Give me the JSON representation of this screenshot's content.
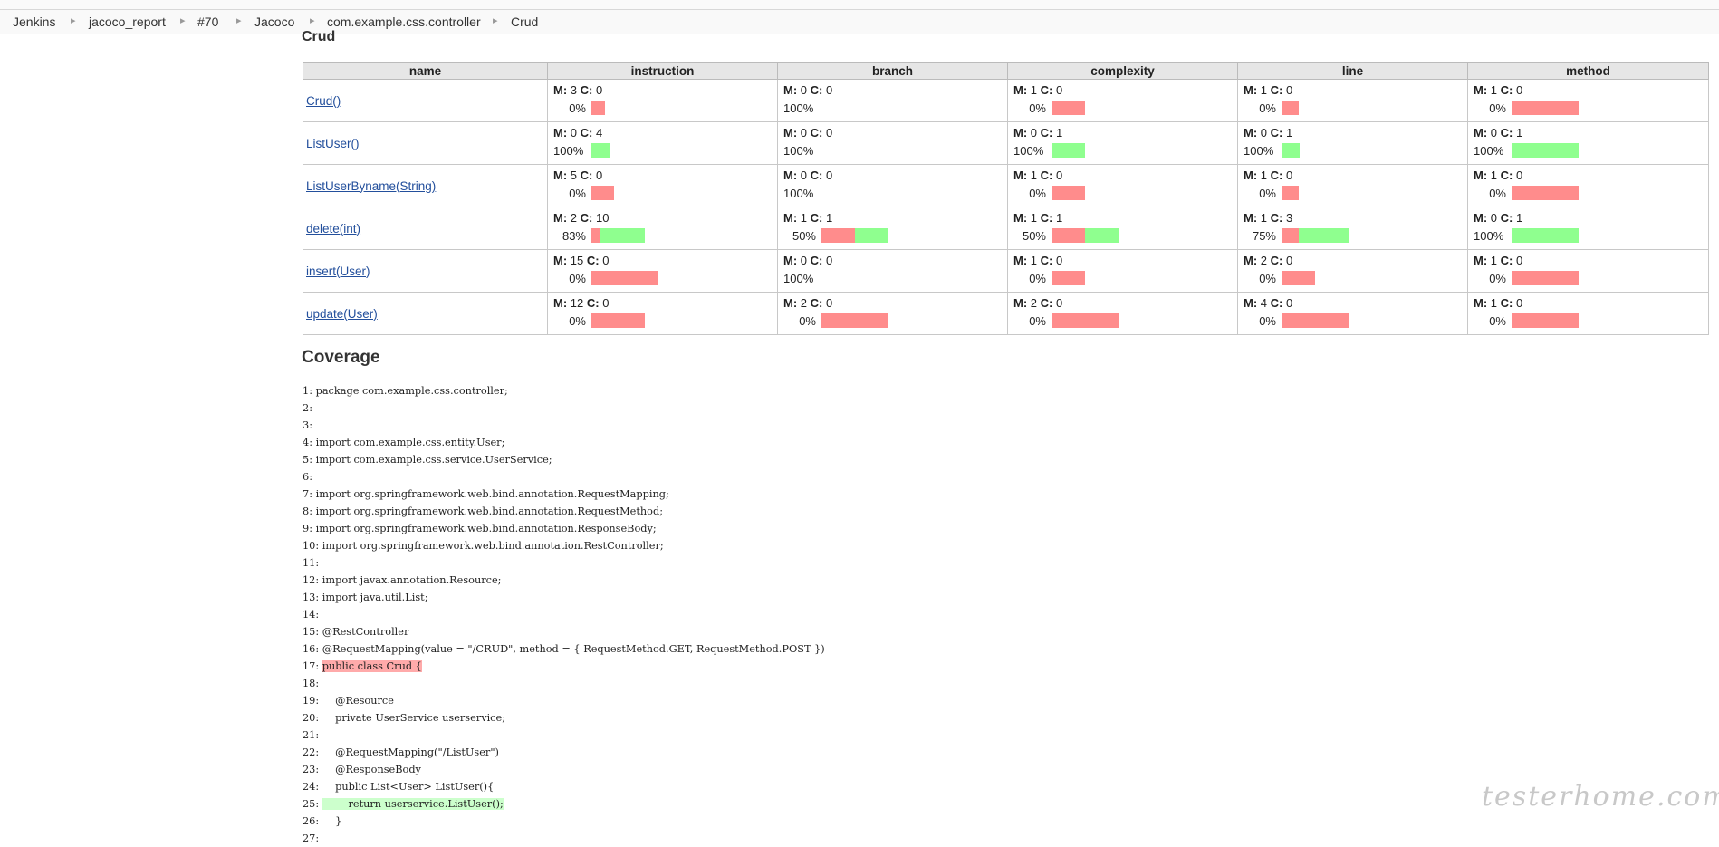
{
  "breadcrumb": {
    "items": [
      "Jenkins",
      "jacoco_report",
      "#70",
      "Jacoco",
      "com.example.css.controller",
      "Crud"
    ]
  },
  "page_title": "Crud",
  "table": {
    "headers": [
      "name",
      "instruction",
      "branch",
      "complexity",
      "line",
      "method"
    ],
    "rows": [
      {
        "name": "Crud()",
        "cells": [
          {
            "m": "3",
            "c": "0",
            "pct": "0%",
            "missed": 3,
            "covered": 0
          },
          {
            "m": "0",
            "c": "0",
            "pct": "100%",
            "missed": 0,
            "covered": 0
          },
          {
            "m": "1",
            "c": "0",
            "pct": "0%",
            "missed": 1,
            "covered": 0
          },
          {
            "m": "1",
            "c": "0",
            "pct": "0%",
            "missed": 1,
            "covered": 0
          },
          {
            "m": "1",
            "c": "0",
            "pct": "0%",
            "missed": 1,
            "covered": 0
          }
        ]
      },
      {
        "name": "ListUser()",
        "cells": [
          {
            "m": "0",
            "c": "4",
            "pct": "100%",
            "missed": 0,
            "covered": 4
          },
          {
            "m": "0",
            "c": "0",
            "pct": "100%",
            "missed": 0,
            "covered": 0
          },
          {
            "m": "0",
            "c": "1",
            "pct": "100%",
            "missed": 0,
            "covered": 1
          },
          {
            "m": "0",
            "c": "1",
            "pct": "100%",
            "missed": 0,
            "covered": 1
          },
          {
            "m": "0",
            "c": "1",
            "pct": "100%",
            "missed": 0,
            "covered": 1
          }
        ]
      },
      {
        "name": "ListUserByname(String)",
        "cells": [
          {
            "m": "5",
            "c": "0",
            "pct": "0%",
            "missed": 5,
            "covered": 0
          },
          {
            "m": "0",
            "c": "0",
            "pct": "100%",
            "missed": 0,
            "covered": 0
          },
          {
            "m": "1",
            "c": "0",
            "pct": "0%",
            "missed": 1,
            "covered": 0
          },
          {
            "m": "1",
            "c": "0",
            "pct": "0%",
            "missed": 1,
            "covered": 0
          },
          {
            "m": "1",
            "c": "0",
            "pct": "0%",
            "missed": 1,
            "covered": 0
          }
        ]
      },
      {
        "name": "delete(int)",
        "cells": [
          {
            "m": "2",
            "c": "10",
            "pct": "83%",
            "missed": 2,
            "covered": 10
          },
          {
            "m": "1",
            "c": "1",
            "pct": "50%",
            "missed": 1,
            "covered": 1
          },
          {
            "m": "1",
            "c": "1",
            "pct": "50%",
            "missed": 1,
            "covered": 1
          },
          {
            "m": "1",
            "c": "3",
            "pct": "75%",
            "missed": 1,
            "covered": 3
          },
          {
            "m": "0",
            "c": "1",
            "pct": "100%",
            "missed": 0,
            "covered": 1
          }
        ]
      },
      {
        "name": "insert(User)",
        "cells": [
          {
            "m": "15",
            "c": "0",
            "pct": "0%",
            "missed": 15,
            "covered": 0
          },
          {
            "m": "0",
            "c": "0",
            "pct": "100%",
            "missed": 0,
            "covered": 0
          },
          {
            "m": "1",
            "c": "0",
            "pct": "0%",
            "missed": 1,
            "covered": 0
          },
          {
            "m": "2",
            "c": "0",
            "pct": "0%",
            "missed": 2,
            "covered": 0
          },
          {
            "m": "1",
            "c": "0",
            "pct": "0%",
            "missed": 1,
            "covered": 0
          }
        ]
      },
      {
        "name": "update(User)",
        "cells": [
          {
            "m": "12",
            "c": "0",
            "pct": "0%",
            "missed": 12,
            "covered": 0
          },
          {
            "m": "2",
            "c": "0",
            "pct": "0%",
            "missed": 2,
            "covered": 0
          },
          {
            "m": "2",
            "c": "0",
            "pct": "0%",
            "missed": 2,
            "covered": 0
          },
          {
            "m": "4",
            "c": "0",
            "pct": "0%",
            "missed": 4,
            "covered": 0
          },
          {
            "m": "1",
            "c": "0",
            "pct": "0%",
            "missed": 1,
            "covered": 0
          }
        ]
      }
    ]
  },
  "coverage_title": "Coverage",
  "source": [
    {
      "num": "1",
      "text": "package com.example.css.controller;",
      "hl": ""
    },
    {
      "num": "2",
      "text": "",
      "hl": ""
    },
    {
      "num": "3",
      "text": "",
      "hl": ""
    },
    {
      "num": "4",
      "text": "import com.example.css.entity.User;",
      "hl": ""
    },
    {
      "num": "5",
      "text": "import com.example.css.service.UserService;",
      "hl": ""
    },
    {
      "num": "6",
      "text": "",
      "hl": ""
    },
    {
      "num": "7",
      "text": "import org.springframework.web.bind.annotation.RequestMapping;",
      "hl": ""
    },
    {
      "num": "8",
      "text": "import org.springframework.web.bind.annotation.RequestMethod;",
      "hl": ""
    },
    {
      "num": "9",
      "text": "import org.springframework.web.bind.annotation.ResponseBody;",
      "hl": ""
    },
    {
      "num": "10",
      "text": "import org.springframework.web.bind.annotation.RestController;",
      "hl": ""
    },
    {
      "num": "11",
      "text": "",
      "hl": ""
    },
    {
      "num": "12",
      "text": "import javax.annotation.Resource;",
      "hl": ""
    },
    {
      "num": "13",
      "text": "import java.util.List;",
      "hl": ""
    },
    {
      "num": "14",
      "text": "",
      "hl": ""
    },
    {
      "num": "15",
      "text": "@RestController",
      "hl": ""
    },
    {
      "num": "16",
      "text": "@RequestMapping(value = \"/CRUD\", method = { RequestMethod.GET, RequestMethod.POST })",
      "hl": ""
    },
    {
      "num": "17",
      "text": "public class Crud {",
      "hl": "red"
    },
    {
      "num": "18",
      "text": "",
      "hl": ""
    },
    {
      "num": "19",
      "text": "    @Resource",
      "hl": ""
    },
    {
      "num": "20",
      "text": "    private UserService userservice;",
      "hl": ""
    },
    {
      "num": "21",
      "text": "",
      "hl": ""
    },
    {
      "num": "22",
      "text": "    @RequestMapping(\"/ListUser\")",
      "hl": ""
    },
    {
      "num": "23",
      "text": "    @ResponseBody",
      "hl": ""
    },
    {
      "num": "24",
      "text": "    public List<User> ListUser(){",
      "hl": ""
    },
    {
      "num": "25",
      "text": "        return userservice.ListUser();",
      "hl": "green"
    },
    {
      "num": "26",
      "text": "    }",
      "hl": ""
    },
    {
      "num": "27",
      "text": "",
      "hl": ""
    }
  ],
  "watermark": "testerhome.com",
  "colors": {
    "missed": "#ff8c8c",
    "covered": "#8fff8f",
    "header_bg": "#e6e6e6"
  }
}
